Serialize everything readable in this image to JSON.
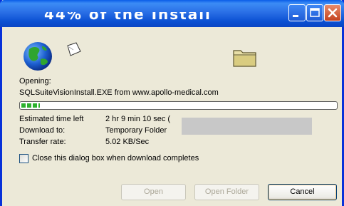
{
  "window": {
    "title": "44% of the Install",
    "controls": {
      "minimize_icon": "minimize-icon",
      "maximize_icon": "maximize-icon",
      "close_icon": "close-icon"
    }
  },
  "icons": {
    "globe": "globe-icon",
    "paper": "paper-icon",
    "folder": "folder-icon"
  },
  "opening_label": "Opening:",
  "file_line": "SQLSuiteVisionInstall.EXE from www.apollo-medical.com",
  "progress": {
    "fraction": 0.06,
    "color": "#2CB12C"
  },
  "details": {
    "time_left": {
      "label": "Estimated time left",
      "value": "2 hr 9 min 10 sec ("
    },
    "download_to": {
      "label": "Download to:",
      "value": "Temporary Folder"
    },
    "transfer_rate": {
      "label": "Transfer rate:",
      "value": "5.02 KB/Sec"
    }
  },
  "close_option": {
    "label": "Close this dialog box when download completes",
    "checked": false
  },
  "buttons": {
    "open": "Open",
    "open_folder": "Open Folder",
    "cancel": "Cancel"
  },
  "colors": {
    "title_bar": "#2A6FE6",
    "dialog_bg": "#ECE9D8",
    "close_button": "#C4421E"
  }
}
